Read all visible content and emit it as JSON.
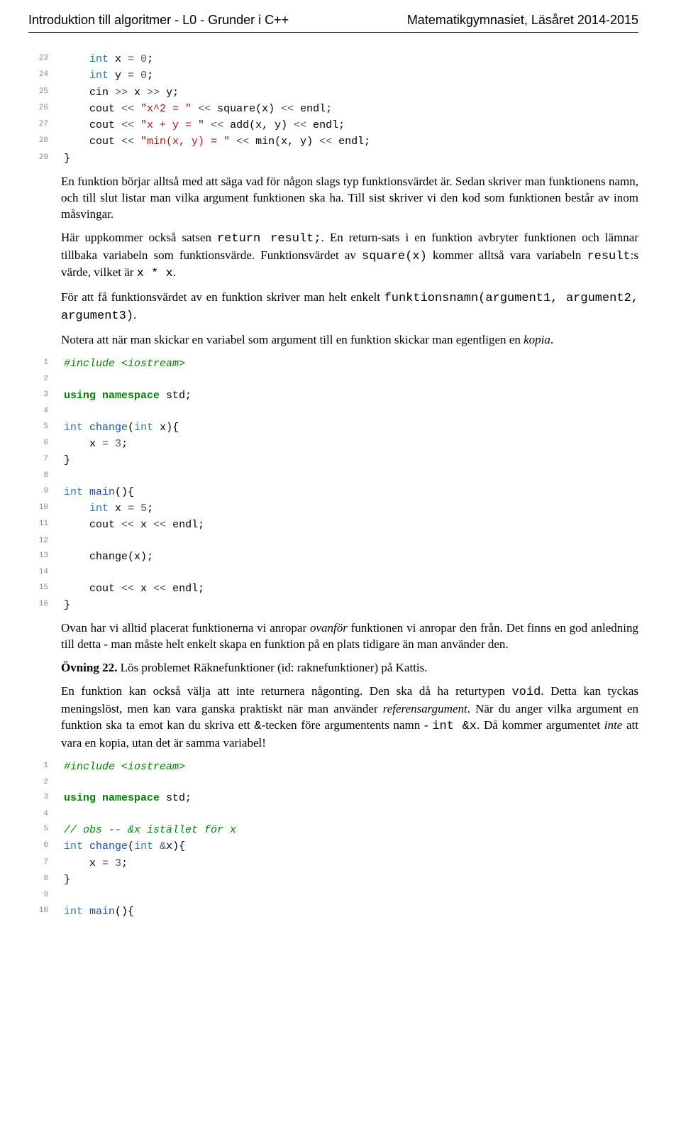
{
  "header": {
    "left": "Introduktion till algoritmer - L0 - Grunder i C++",
    "right": "Matematikgymnasiet, Läsåret 2014-2015"
  },
  "code1": {
    "start": 23,
    "lines": [
      {
        "t": "    <span class='type'>int</span> x <span class='op'>=</span> <span class='num'>0</span>;"
      },
      {
        "t": "    <span class='type'>int</span> y <span class='op'>=</span> <span class='num'>0</span>;"
      },
      {
        "t": "    cin <span class='op'>&gt;&gt;</span> x <span class='op'>&gt;&gt;</span> y;"
      },
      {
        "t": "    cout <span class='op'>&lt;&lt;</span> <span class='str'>\"x^2 = \"</span> <span class='op'>&lt;&lt;</span> square(x) <span class='op'>&lt;&lt;</span> endl;"
      },
      {
        "t": "    cout <span class='op'>&lt;&lt;</span> <span class='str'>\"x + y = \"</span> <span class='op'>&lt;&lt;</span> add(x, y) <span class='op'>&lt;&lt;</span> endl;"
      },
      {
        "t": "    cout <span class='op'>&lt;&lt;</span> <span class='str'>\"min(x, y) = \"</span> <span class='op'>&lt;&lt;</span> min(x, y) <span class='op'>&lt;&lt;</span> endl;"
      },
      {
        "t": "}"
      }
    ]
  },
  "para1": "En funktion börjar alltså med att säga vad för någon slags typ funktionsvärdet är. Sedan skriver man funktionens namn, och till slut listar man vilka argument funktionen ska ha. Till sist skriver vi den kod som funktionen består av inom måsvingar.",
  "para2_a": "Här uppkommer också satsen ",
  "para2_code1": "return result;",
  "para2_b": ". En return-sats i en funktion avbryter funktionen och lämnar tillbaka variabeln som funktionsvärde. Funktionsvärdet av ",
  "para2_code2": "square(x)",
  "para2_c": " kommer alltså vara variabeln ",
  "para2_code3": "result",
  "para2_d": ":s värde, vilket är ",
  "para2_code4": "x * x",
  "para2_e": ".",
  "para3_a": "För att få funktionsvärdet av en funktion skriver man helt enkelt ",
  "para3_code1": "funktionsnamn(argument1, argument2, argument3)",
  "para3_b": ".",
  "para4_a": "Notera att när man skickar en variabel som argument till en funktion skickar man egentligen en ",
  "para4_i": "kopia",
  "para4_b": ".",
  "code2": {
    "start": 1,
    "lines": [
      {
        "t": "<span class='pp'>#include &lt;iostream&gt;</span>"
      },
      {
        "t": ""
      },
      {
        "t": "<span class='keyw'>using namespace</span> std;"
      },
      {
        "t": ""
      },
      {
        "t": "<span class='type'>int</span> <span class='fn'>change</span>(<span class='type'>int</span> x){"
      },
      {
        "t": "    x <span class='op'>=</span> <span class='num'>3</span>;"
      },
      {
        "t": "}"
      },
      {
        "t": ""
      },
      {
        "t": "<span class='type'>int</span> <span class='fn'>main</span>(){"
      },
      {
        "t": "    <span class='type'>int</span> x <span class='op'>=</span> <span class='num'>5</span>;"
      },
      {
        "t": "    cout <span class='op'>&lt;&lt;</span> x <span class='op'>&lt;&lt;</span> endl;"
      },
      {
        "t": ""
      },
      {
        "t": "    change(x);"
      },
      {
        "t": ""
      },
      {
        "t": "    cout <span class='op'>&lt;&lt;</span> x <span class='op'>&lt;&lt;</span> endl;"
      },
      {
        "t": "}"
      }
    ]
  },
  "para5_a": "Ovan har vi alltid placerat funktionerna vi anropar ",
  "para5_i": "ovanför",
  "para5_b": " funktionen vi anropar den från. Det finns en god anledning till detta - man måste helt enkelt skapa en funktion på en plats tidigare än man använder den.",
  "ovning_label": "Övning 22.",
  "ovning_text": " Lös problemet Räknefunktioner (id: raknefunktioner) på Kattis.",
  "para6_a": "En funktion kan också välja att inte returnera någonting. Den ska då ha returtypen ",
  "para6_code1": "void",
  "para6_b": ". Detta kan tyckas meningslöst, men kan vara ganska praktiskt när man använder ",
  "para6_i": "referensargument",
  "para6_c": ". När du anger vilka argument en funktion ska ta emot kan du skriva ett ",
  "para6_code2": "&",
  "para6_d": "-tecken före argumentents namn - ",
  "para6_code3": "int &x",
  "para6_e": ". Då kommer argumentet ",
  "para6_i2": "inte",
  "para6_f": " att vara en kopia, utan det är samma variabel!",
  "code3": {
    "start": 1,
    "lines": [
      {
        "t": "<span class='pp'>#include &lt;iostream&gt;</span>"
      },
      {
        "t": ""
      },
      {
        "t": "<span class='keyw'>using namespace</span> std;"
      },
      {
        "t": ""
      },
      {
        "t": "<span class='comment'>// obs -- &amp;x istället för x</span>"
      },
      {
        "t": "<span class='type'>int</span> <span class='fn'>change</span>(<span class='type'>int</span> <span class='op'>&amp;</span>x){"
      },
      {
        "t": "    x <span class='op'>=</span> <span class='num'>3</span>;"
      },
      {
        "t": "}"
      },
      {
        "t": ""
      },
      {
        "t": "<span class='type'>int</span> <span class='fn'>main</span>(){"
      }
    ]
  }
}
